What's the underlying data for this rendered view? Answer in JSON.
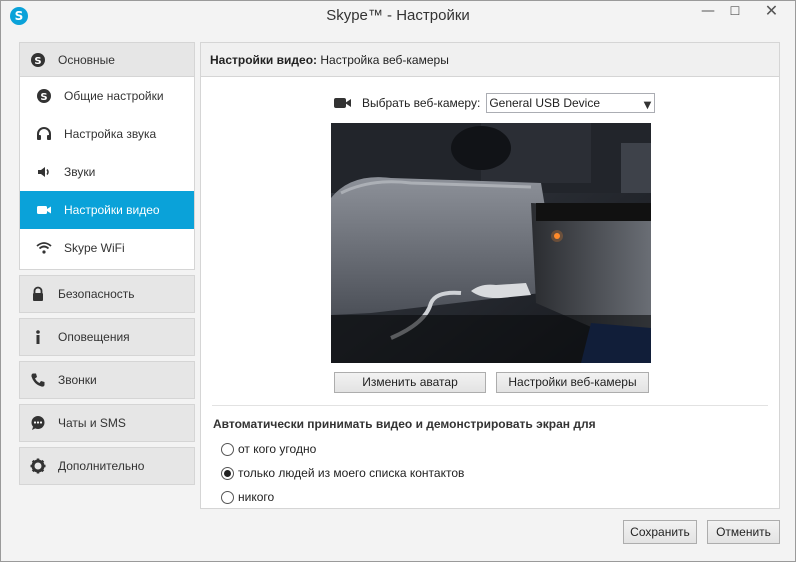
{
  "window": {
    "title": "Skype™ - Настройки",
    "app_icon_letter": "S",
    "minimize": "—",
    "maximize": "☐",
    "close": "✕"
  },
  "sidebar": {
    "groups": [
      {
        "label": "Основные",
        "icon": "skype-icon"
      },
      {
        "label": "Безопасность",
        "icon": "lock-icon"
      },
      {
        "label": "Оповещения",
        "icon": "info-icon"
      },
      {
        "label": "Звонки",
        "icon": "phone-icon"
      },
      {
        "label": "Чаты и SMS",
        "icon": "chat-icon"
      },
      {
        "label": "Дополнительно",
        "icon": "gear-icon"
      }
    ],
    "sub_items": [
      {
        "label": "Общие настройки",
        "icon": "skype-icon"
      },
      {
        "label": "Настройка звука",
        "icon": "headset-icon"
      },
      {
        "label": "Звуки",
        "icon": "speaker-icon"
      },
      {
        "label": "Настройки видео",
        "icon": "video-camera-icon",
        "active": true
      },
      {
        "label": "Skype WiFi",
        "icon": "wifi-icon"
      }
    ]
  },
  "main": {
    "header_bold": "Настройки видео:",
    "header_rest": "Настройка веб-камеры",
    "camera_label": "Выбрать веб-камеру:",
    "camera_selected": "General USB Device",
    "change_avatar": "Изменить аватар",
    "webcam_settings": "Настройки веб-камеры",
    "auto_accept_title": "Автоматически принимать видео и демонстрировать экран для",
    "radio_options": [
      {
        "label": "от кого угодно",
        "checked": false
      },
      {
        "label": "только людей из моего списка контактов",
        "checked": true
      },
      {
        "label": "никого",
        "checked": false
      }
    ]
  },
  "footer": {
    "save": "Сохранить",
    "cancel": "Отменить"
  },
  "colors": {
    "accent": "#0aa2d9"
  }
}
